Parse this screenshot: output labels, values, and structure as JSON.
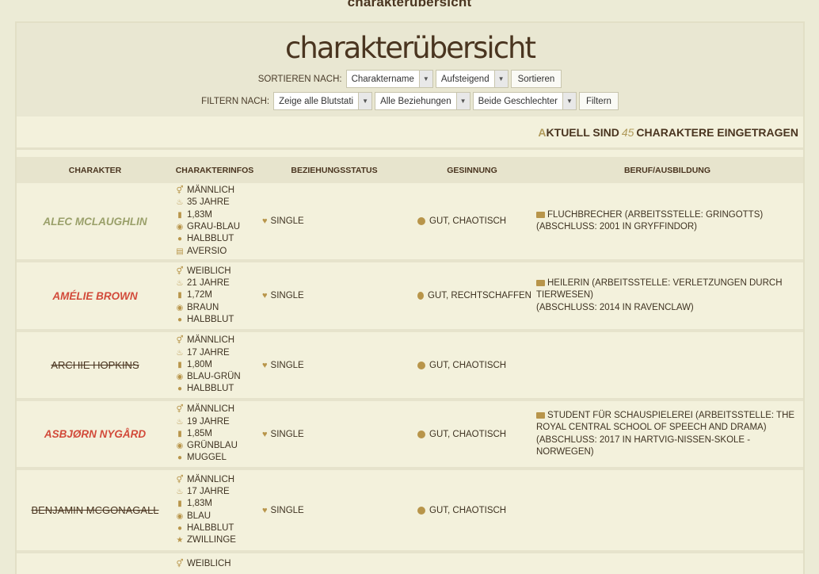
{
  "page": {
    "crumb": "charakterübersicht",
    "title": "charakterübersicht"
  },
  "sort": {
    "label": "SORTIEREN NACH:",
    "by": "Charaktername",
    "order": "Aufsteigend",
    "button": "Sortieren"
  },
  "filter": {
    "label": "FILTERN NACH:",
    "blood": "Zeige alle Blutstati",
    "relation": "Alle Beziehungen",
    "gender": "Beide Geschlechter",
    "button": "Filtern"
  },
  "count": {
    "first_letter": "A",
    "rest_before": "KTUELL SIND",
    "number": "45",
    "after": "CHARAKTERE EINGETRAGEN"
  },
  "columns": [
    "CHARAKTER",
    "CHARAKTERINFOS",
    "BEZIEHUNGSSTATUS",
    "GESINNUNG",
    "BERUF/AUSBILDUNG"
  ],
  "characters": [
    {
      "name": "ALEC MCLAUGHLIN",
      "style": "green",
      "gender": "MÄNNLICH",
      "age": "35 JAHRE",
      "height": "1,83M",
      "eyes": "GRAU-BLAU",
      "blood": "HALBBLUT",
      "extra_icon": "document-icon",
      "extra": "AVERSIO",
      "status": "SINGLE",
      "alignment": "GUT, CHAOTISCH",
      "job": "FLUCHBRECHER (ARBEITSSTELLE: GRINGOTTS)",
      "school": "(ABSCHLUSS: 2001 IN GRYFFINDOR)"
    },
    {
      "name": "AMÉLIE BROWN",
      "style": "red",
      "gender": "WEIBLICH",
      "age": "21 JAHRE",
      "height": "1,72M",
      "eyes": "BRAUN",
      "blood": "HALBBLUT",
      "extra_icon": "",
      "extra": "",
      "status": "SINGLE",
      "alignment": "GUT, RECHTSCHAFFEN",
      "job": "HEILERIN (ARBEITSSTELLE: VERLETZUNGEN DURCH TIERWESEN)",
      "school": "(ABSCHLUSS: 2014 IN RAVENCLAW)"
    },
    {
      "name": "ARCHIE HOPKINS",
      "style": "struck",
      "gender": "MÄNNLICH",
      "age": "17 JAHRE",
      "height": "1,80M",
      "eyes": "BLAU-GRÜN",
      "blood": "HALBBLUT",
      "extra_icon": "",
      "extra": "",
      "status": "SINGLE",
      "alignment": "GUT, CHAOTISCH",
      "job": "",
      "school": ""
    },
    {
      "name": "ASBJØRN NYGÅRD",
      "style": "red",
      "gender": "MÄNNLICH",
      "age": "19 JAHRE",
      "height": "1,85M",
      "eyes": "GRÜNBLAU",
      "blood": "MUGGEL",
      "extra_icon": "",
      "extra": "",
      "status": "SINGLE",
      "alignment": "GUT, CHAOTISCH",
      "job": "STUDENT FÜR SCHAUSPIELEREI (ARBEITSSTELLE: THE ROYAL CENTRAL SCHOOL OF SPEECH AND DRAMA)",
      "school": "(ABSCHLUSS: 2017 IN HARTVIG-NISSEN-SKOLE - NORWEGEN)"
    },
    {
      "name": "BENJAMIN MCGONAGALL",
      "style": "struck",
      "gender": "MÄNNLICH",
      "age": "17 JAHRE",
      "height": "1,83M",
      "eyes": "BLAU",
      "blood": "HALBBLUT",
      "extra_icon": "star-icon",
      "extra": "ZWILLINGE",
      "status": "SINGLE",
      "alignment": "GUT, CHAOTISCH",
      "job": "",
      "school": ""
    },
    {
      "name": "",
      "style": "red",
      "gender": "WEIBLICH",
      "age": "",
      "height": "",
      "eyes": "",
      "blood": "",
      "extra_icon": "",
      "extra": "",
      "status": "",
      "alignment": "",
      "job": "",
      "school": ""
    }
  ]
}
